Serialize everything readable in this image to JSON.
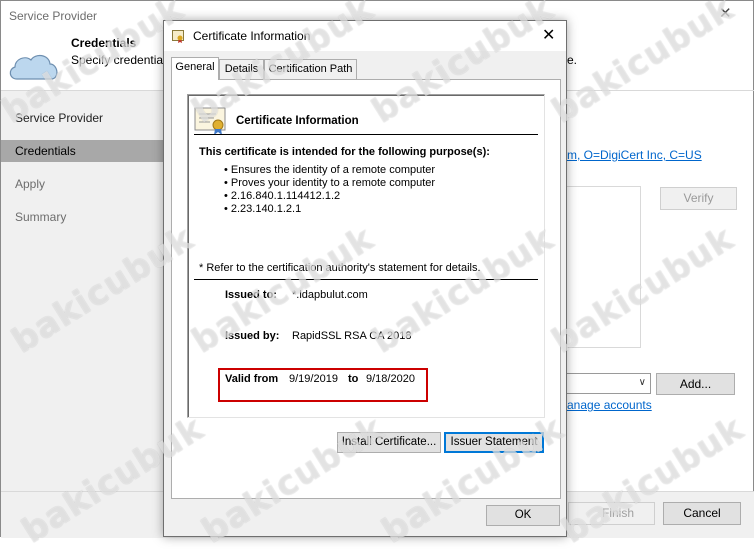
{
  "wizard": {
    "title": "Service Provider",
    "header_title": "Credentials",
    "header_subtitle": "Specify credential",
    "header_subtitle_tail": "e.",
    "nav": [
      "Service Provider",
      "Credentials",
      "Apply",
      "Summary"
    ],
    "active_nav": "Credentials",
    "issuer_link": "m, O=DigiCert Inc, C=US",
    "verify_label": "Verify",
    "add_label": "Add...",
    "manage_link": "anage accounts",
    "finish_label": "Finish",
    "cancel_label": "Cancel"
  },
  "dialog": {
    "title": "Certificate Information",
    "tabs": [
      "General",
      "Details",
      "Certification Path"
    ],
    "selected_tab": "General",
    "cert_title": "Certificate Information",
    "purpose_heading": "This certificate is intended for the following purpose(s):",
    "purposes": [
      "Ensures the identity of a remote computer",
      "Proves your identity to a remote computer",
      "2.16.840.1.114412.1.2",
      "2.23.140.1.2.1"
    ],
    "note": "* Refer to the certification authority's statement for details.",
    "issued_to_label": "Issued to:",
    "issued_to": "*.ldapbulut.com",
    "issued_by_label": "Issued by:",
    "issued_by": "RapidSSL RSA CA 2018",
    "valid_from_label": "Valid from",
    "valid_from": "9/19/2019",
    "valid_to_label": "to",
    "valid_to": "9/18/2020",
    "install_label": "Install Certificate...",
    "issuer_statement_label": "Issuer Statement",
    "ok_label": "OK"
  },
  "watermark": "bakicubuk",
  "colors": {
    "highlight_box": "#cc0000",
    "link": "#0066cc",
    "focus": "#0078d7"
  }
}
